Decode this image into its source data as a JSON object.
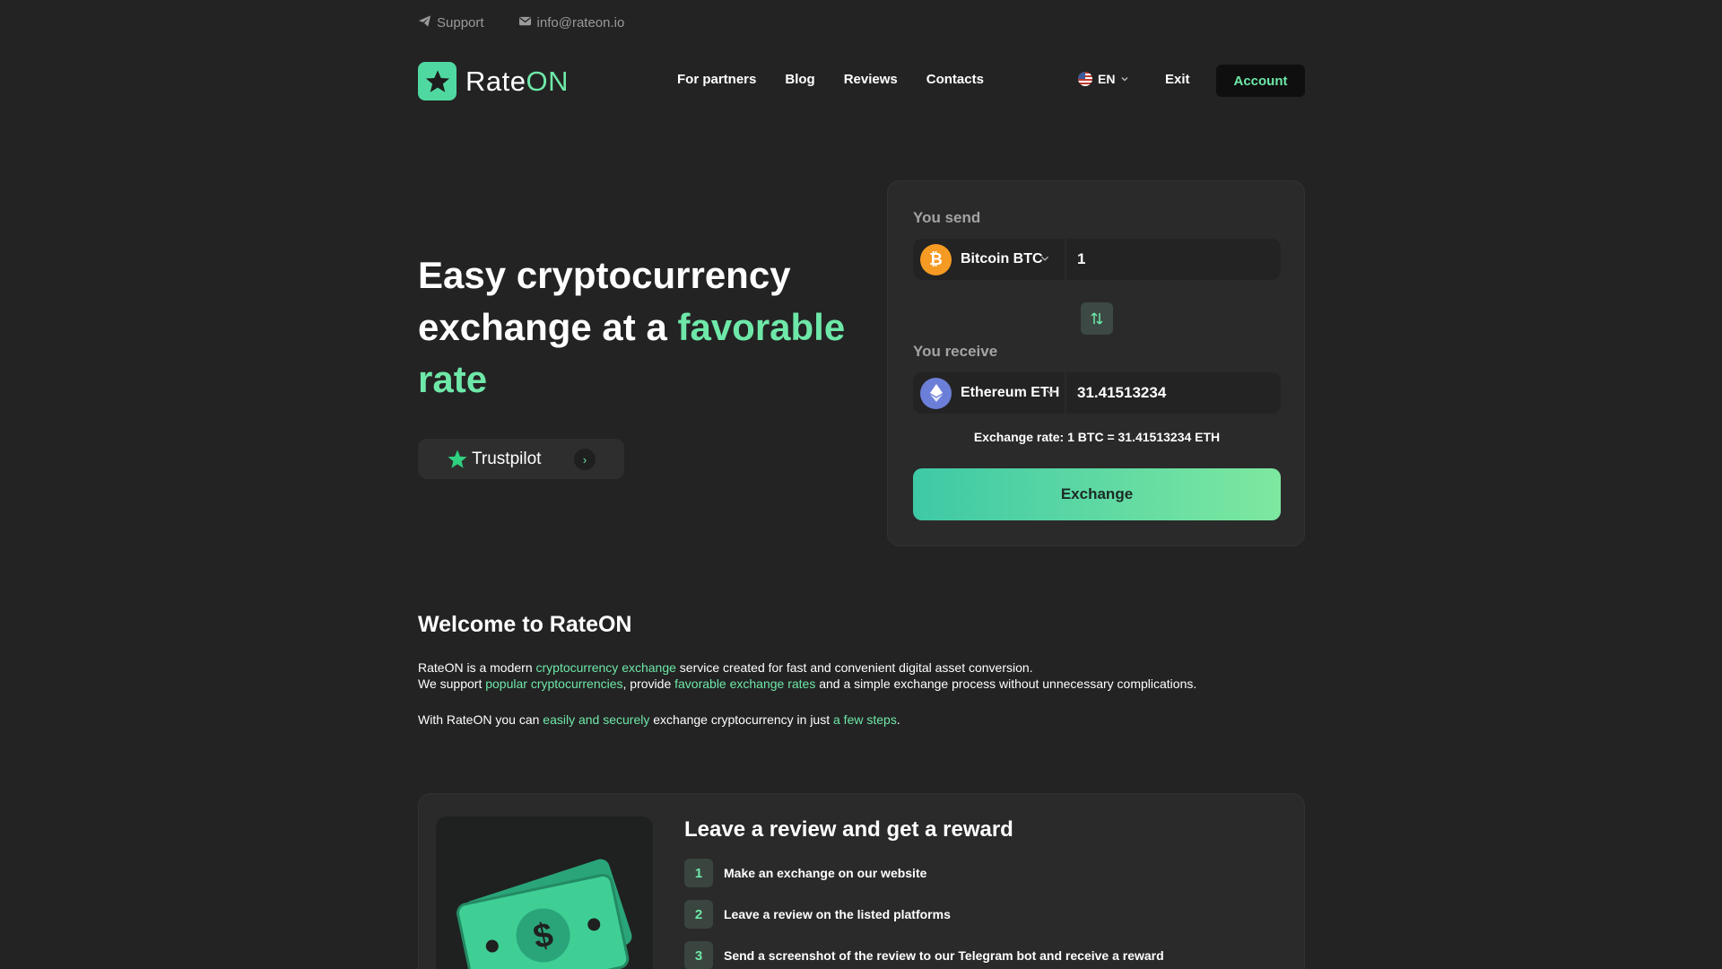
{
  "topbar": {
    "support": "Support",
    "email": "info@rateon.io"
  },
  "brand": {
    "name_part1": "Rate",
    "name_part2": "ON",
    "accent": "#6ee8a8"
  },
  "nav": {
    "items": [
      "For partners",
      "Blog",
      "Reviews",
      "Contacts"
    ],
    "language": "EN",
    "exit": "Exit",
    "account": "Account"
  },
  "hero": {
    "title_part1": "Easy cryptocurrency exchange at a ",
    "title_accent": "favorable rate",
    "trustpilot": "Trustpilot"
  },
  "exchange": {
    "send_label": "You send",
    "send_currency": "Bitcoin BTC",
    "send_amount": "1",
    "receive_label": "You receive",
    "receive_currency": "Ethereum ETH",
    "receive_amount": "31.41513234",
    "rate": "Exchange rate: 1 BTC = 31.41513234 ETH",
    "button": "Exchange"
  },
  "welcome": {
    "title": "Welcome to RateON",
    "l1_a": "RateON is a modern ",
    "l1_link": "cryptocurrency exchange",
    "l1_b": " service created for fast and convenient digital asset conversion.",
    "l2_a": "We support ",
    "l2_link1": "popular cryptocurrencies",
    "l2_b": ", provide ",
    "l2_link2": "favorable exchange rates",
    "l2_c": " and a simple exchange process without unnecessary complications.",
    "l3_a": "With RateON you can ",
    "l3_link1": "easily and securely",
    "l3_b": " exchange cryptocurrency in just ",
    "l3_link2": "a few steps",
    "l3_c": "."
  },
  "review": {
    "title": "Leave a review and get a reward",
    "steps": [
      {
        "num": "1",
        "text": "Make an exchange on our website"
      },
      {
        "num": "2",
        "text": "Leave a review on the listed platforms"
      },
      {
        "num": "3",
        "text": "Send a screenshot of the review to our Telegram bot and receive a reward"
      }
    ]
  }
}
